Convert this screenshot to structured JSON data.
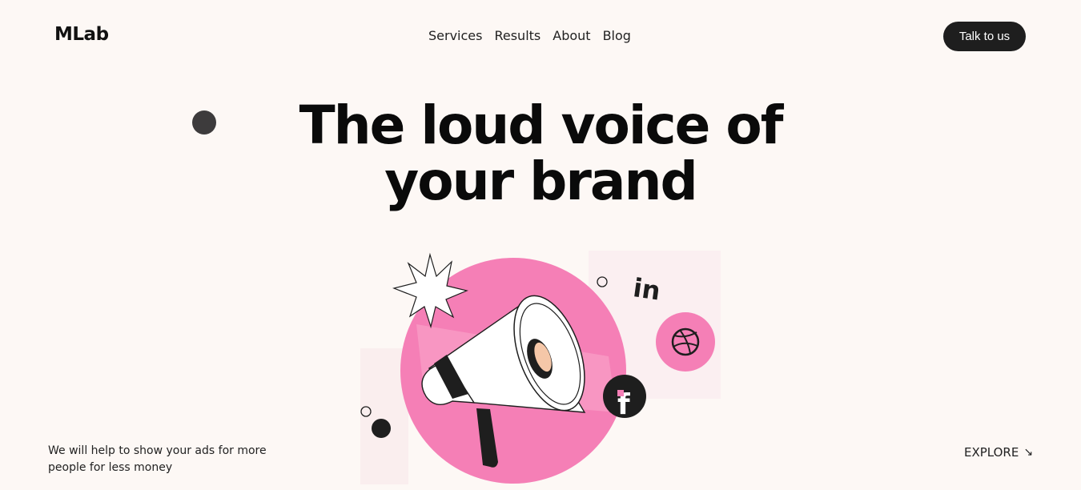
{
  "header": {
    "logo": "MLab",
    "nav": [
      "Services",
      "Results",
      "About",
      "Blog"
    ],
    "cta": "Talk to us"
  },
  "hero": {
    "line1": "The loud voice of",
    "line2": "your brand"
  },
  "illustration": {
    "icons": [
      "megaphone-icon",
      "starburst-icon",
      "linkedin-icon",
      "dribbble-icon",
      "facebook-icon"
    ],
    "linkedin_text": "in",
    "facebook_text": "f",
    "colors": {
      "pink": "#f57fb6",
      "pink_light": "#fbbad7",
      "dark": "#1e1e1e",
      "accent": "#f5c7a8"
    }
  },
  "footer": {
    "tagline": "We will help to show your ads for more people for less money",
    "explore": "EXPLORE",
    "explore_icon": "arrow-down-right-icon"
  }
}
